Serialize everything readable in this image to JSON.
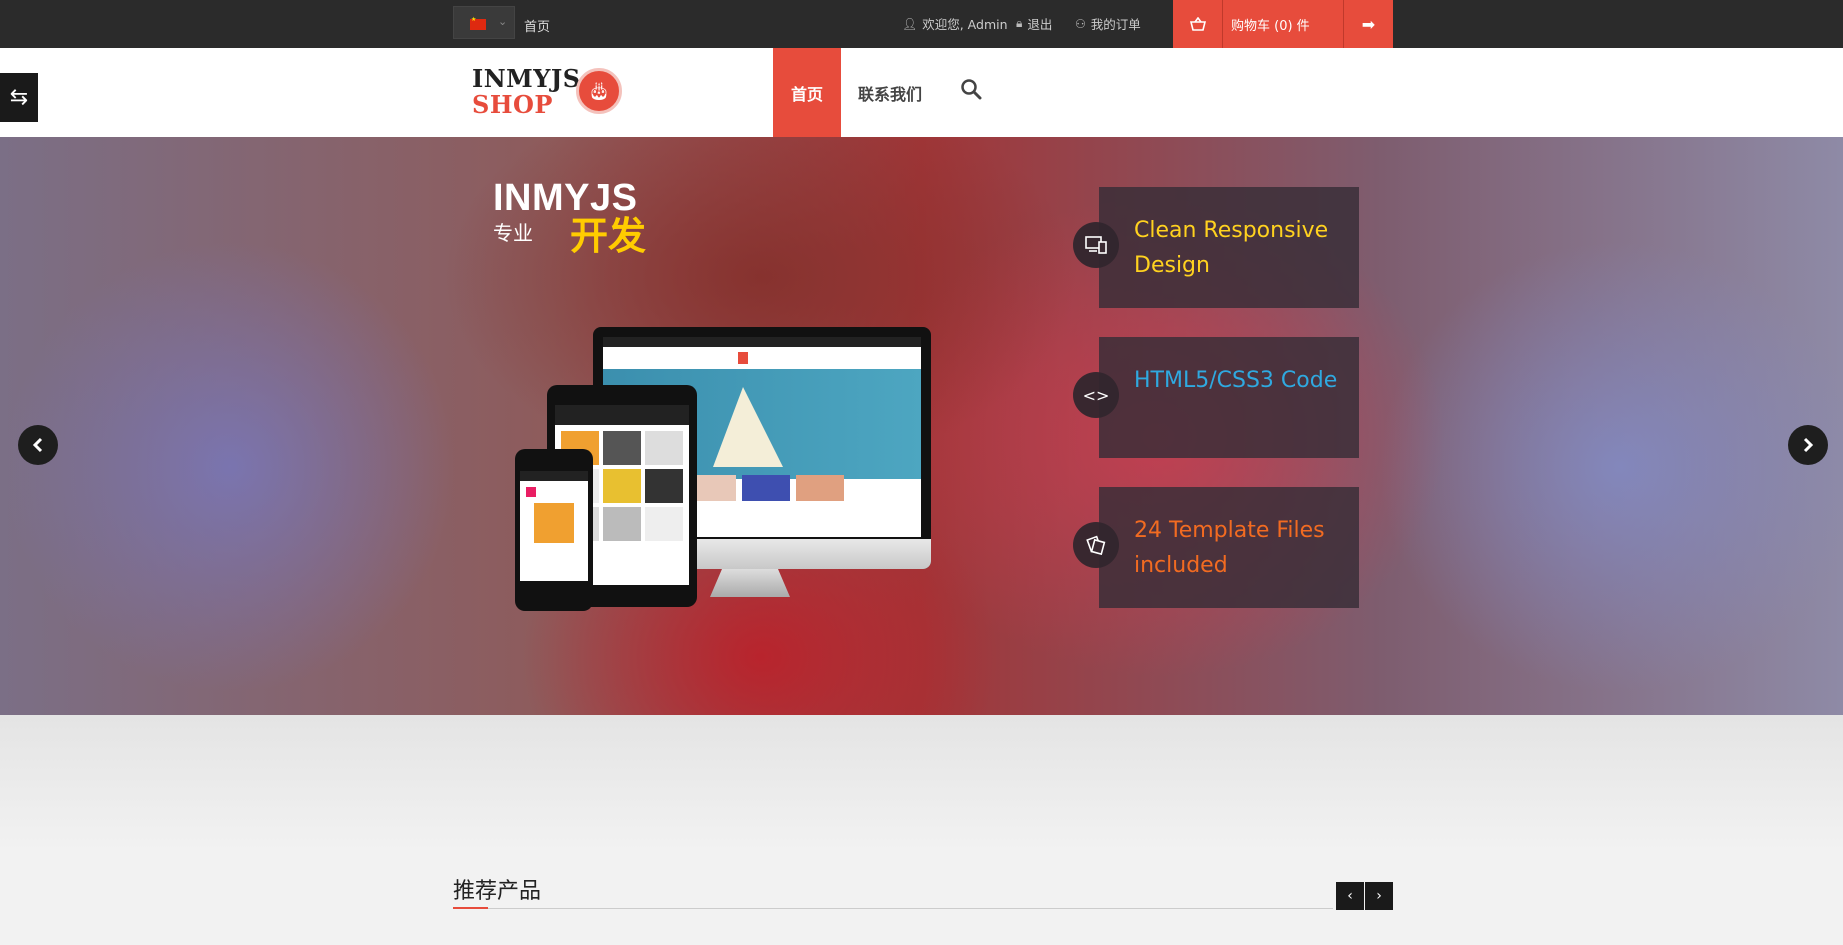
{
  "topbar": {
    "home_label": "首页",
    "welcome": "欢迎您, Admin",
    "logout": "退出",
    "orders": "我的订单",
    "cart_label": "购物车 (0) 件"
  },
  "header": {
    "logo_top": "INMYJS",
    "logo_bottom": "SHOP",
    "nav_home": "首页",
    "nav_contact": "联系我们"
  },
  "slider": {
    "title": "INMYJS",
    "subtitle_small": "专业",
    "subtitle_big": "开发",
    "features": [
      {
        "text": "Clean Responsive Design",
        "color": "#ffd21f",
        "icon": "devices-icon"
      },
      {
        "text": "HTML5/CSS3 Code",
        "color": "#2fa9e0",
        "icon": "code-icon"
      },
      {
        "text": "24 Template Files included",
        "color": "#f26b21",
        "icon": "files-icon"
      }
    ]
  },
  "section": {
    "title": "推荐产品"
  },
  "colors": {
    "accent": "#e74c3c",
    "topbar": "#2b2b2b"
  }
}
